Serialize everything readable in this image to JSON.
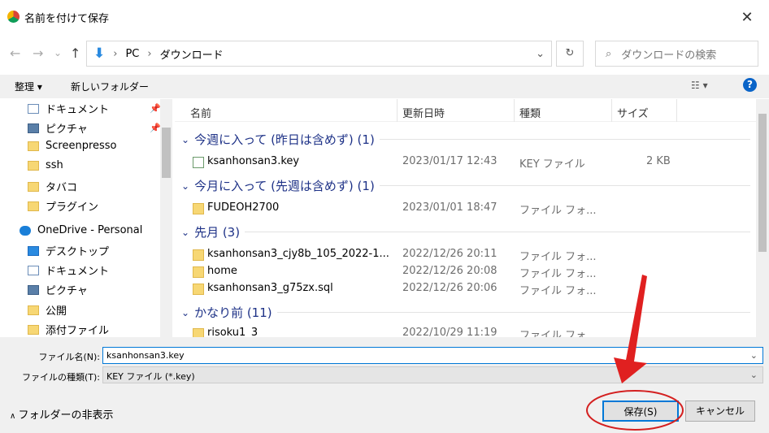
{
  "window": {
    "title": "名前を付けて保存",
    "close": "✕"
  },
  "nav": {
    "back": "←",
    "forward": "→",
    "recent": "⌄",
    "up": "↑",
    "path": [
      "PC",
      "ダウンロード"
    ],
    "refresh": "↻",
    "search_placeholder": "ダウンロードの検索"
  },
  "toolbar": {
    "organize": "整理 ▾",
    "new_folder": "新しいフォルダー",
    "view": "☷ ▾",
    "help": "?"
  },
  "sidebar": {
    "items": [
      {
        "label": "ドキュメント",
        "icon": "document-icon",
        "pinned": true
      },
      {
        "label": "ピクチャ",
        "icon": "picture-icon",
        "pinned": true
      },
      {
        "label": "Screenpresso",
        "icon": "folder-icon"
      },
      {
        "label": "ssh",
        "icon": "folder-icon"
      },
      {
        "label": "タバコ",
        "icon": "folder-icon"
      },
      {
        "label": "プラグイン",
        "icon": "folder-icon"
      },
      {
        "label": "OneDrive - Personal",
        "icon": "cloud-icon"
      },
      {
        "label": "デスクトップ",
        "icon": "desktop-icon"
      },
      {
        "label": "ドキュメント",
        "icon": "document-icon"
      },
      {
        "label": "ピクチャ",
        "icon": "picture-icon"
      },
      {
        "label": "公開",
        "icon": "folder-icon"
      },
      {
        "label": "添付ファイル",
        "icon": "folder-icon"
      }
    ]
  },
  "list": {
    "columns": [
      "名前",
      "更新日時",
      "種類",
      "サイズ"
    ],
    "groups": [
      {
        "label": "今週に入って (昨日は含めず) (1)",
        "rows": [
          {
            "name": "ksanhonsan3.key",
            "date": "2023/01/17 12:43",
            "type": "KEY ファイル",
            "size": "2 KB"
          }
        ]
      },
      {
        "label": "今月に入って (先週は含めず) (1)",
        "rows": [
          {
            "name": "FUDEOH2700",
            "date": "2023/01/01 18:47",
            "type": "ファイル フォ...",
            "size": ""
          }
        ]
      },
      {
        "label": "先月 (3)",
        "rows": [
          {
            "name": "ksanhonsan3_cjy8b_105_2022-1...",
            "date": "2022/12/26 20:11",
            "type": "ファイル フォ...",
            "size": ""
          },
          {
            "name": "home",
            "date": "2022/12/26 20:08",
            "type": "ファイル フォ...",
            "size": ""
          },
          {
            "name": "ksanhonsan3_g75zx.sql",
            "date": "2022/12/26 20:06",
            "type": "ファイル フォ...",
            "size": ""
          }
        ]
      },
      {
        "label": "かなり前 (11)",
        "rows": [
          {
            "name": "risoku1_3",
            "date": "2022/10/29 11:19",
            "type": "ファイル フォ...",
            "size": ""
          }
        ]
      }
    ]
  },
  "form": {
    "filename_label": "ファイル名(N):",
    "filename_value": "ksanhonsan3.key",
    "filetype_label": "ファイルの種類(T):",
    "filetype_value": "KEY ファイル (*.key)",
    "hide_folders": "フォルダーの非表示",
    "save": "保存(S)",
    "cancel": "キャンセル"
  },
  "colors": {
    "accent": "#0078d7",
    "annotation": "#e02020",
    "group_header": "#1e3287"
  }
}
